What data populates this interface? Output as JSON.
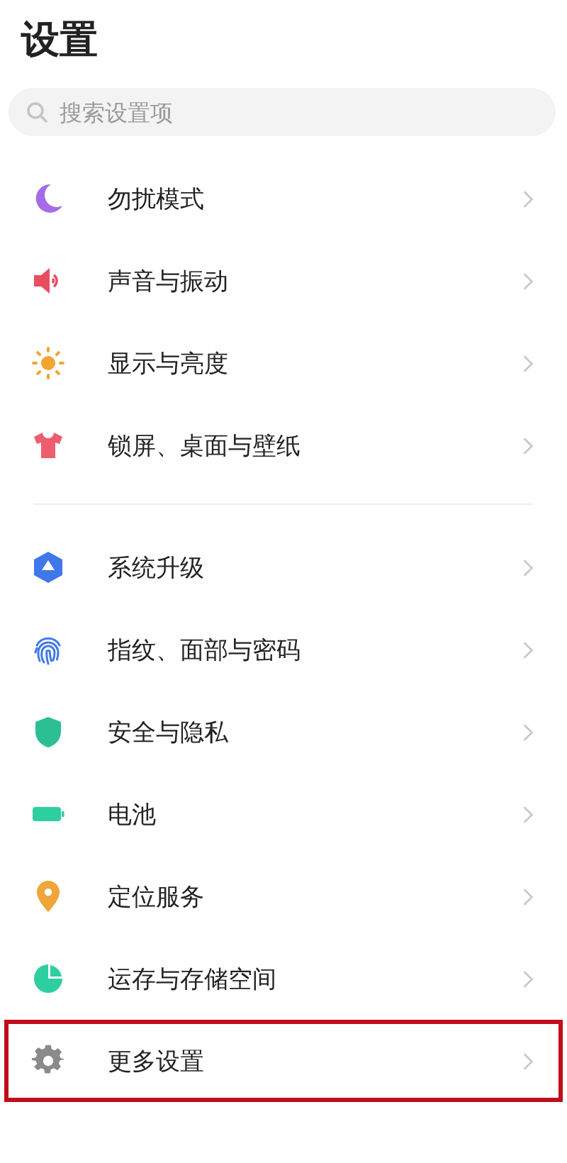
{
  "title": "设置",
  "search": {
    "placeholder": "搜索设置项"
  },
  "groups": [
    {
      "items": [
        {
          "kind": "moon",
          "label": "勿扰模式",
          "highlighted": false
        },
        {
          "kind": "speaker",
          "label": "声音与振动",
          "highlighted": false
        },
        {
          "kind": "sun",
          "label": "显示与亮度",
          "highlighted": false
        },
        {
          "kind": "shirt",
          "label": "锁屏、桌面与壁纸",
          "highlighted": false
        }
      ]
    },
    {
      "items": [
        {
          "kind": "update",
          "label": "系统升级",
          "highlighted": false
        },
        {
          "kind": "fingerprint",
          "label": "指纹、面部与密码",
          "highlighted": false
        },
        {
          "kind": "shield",
          "label": "安全与隐私",
          "highlighted": false
        },
        {
          "kind": "battery",
          "label": "电池",
          "highlighted": false
        },
        {
          "kind": "pin",
          "label": "定位服务",
          "highlighted": false
        },
        {
          "kind": "pie",
          "label": "运存与存储空间",
          "highlighted": false
        },
        {
          "kind": "gear",
          "label": "更多设置",
          "highlighted": true
        }
      ]
    }
  ]
}
